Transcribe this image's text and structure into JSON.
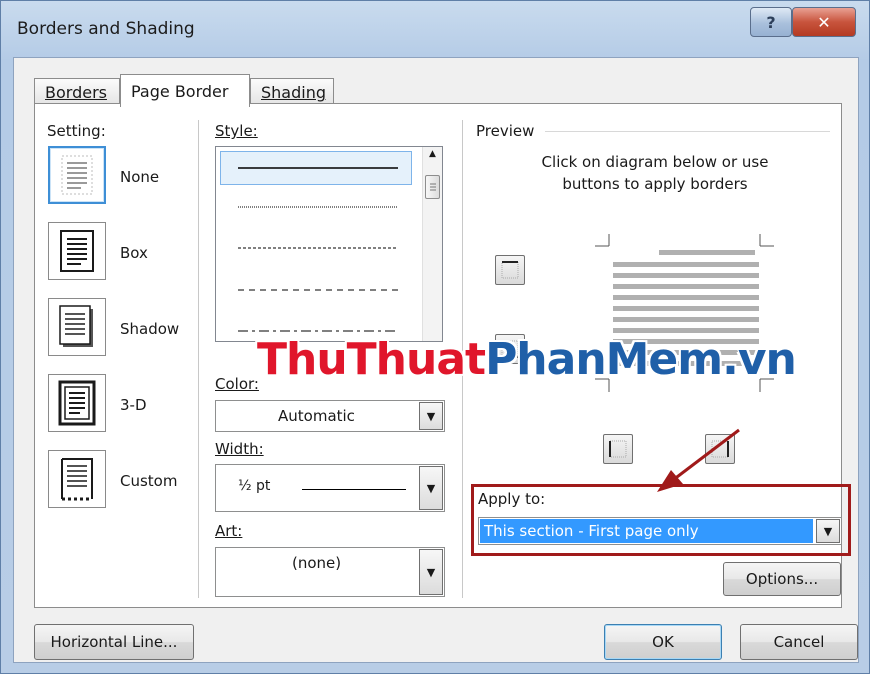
{
  "window": {
    "title": "Borders and Shading",
    "help_label": "?",
    "close_label": "✕"
  },
  "tabs": [
    {
      "label": "Borders",
      "active": false
    },
    {
      "label": "Page Border",
      "active": true
    },
    {
      "label": "Shading",
      "active": false
    }
  ],
  "setting": {
    "label": "Setting:",
    "options": [
      {
        "label": "None",
        "selected": true
      },
      {
        "label": "Box",
        "selected": false
      },
      {
        "label": "Shadow",
        "selected": false
      },
      {
        "label": "3-D",
        "selected": false
      },
      {
        "label": "Custom",
        "selected": false
      }
    ]
  },
  "style": {
    "label": "Style:",
    "options": [
      "solid",
      "dotted",
      "dashed-fine",
      "dashed",
      "dash-dot"
    ]
  },
  "color": {
    "label": "Color:",
    "value": "Automatic"
  },
  "width": {
    "label": "Width:",
    "value": "½ pt"
  },
  "art": {
    "label": "Art:",
    "value": "(none)"
  },
  "preview": {
    "label": "Preview",
    "instruction_line1": "Click on diagram below or use",
    "instruction_line2": "buttons to apply borders"
  },
  "apply_to": {
    "label": "Apply to:",
    "value": "This section - First page only"
  },
  "buttons": {
    "options": "Options...",
    "horizontal_line": "Horizontal Line...",
    "ok": "OK",
    "cancel": "Cancel"
  },
  "watermark": {
    "part1": "ThuThuat",
    "part2": "PhanMem",
    "part3": ".vn"
  },
  "colors": {
    "highlight": "#3399ff",
    "annotation": "#a01a1a",
    "watermark_red": "#e0162b",
    "watermark_blue": "#1f5fa8"
  }
}
